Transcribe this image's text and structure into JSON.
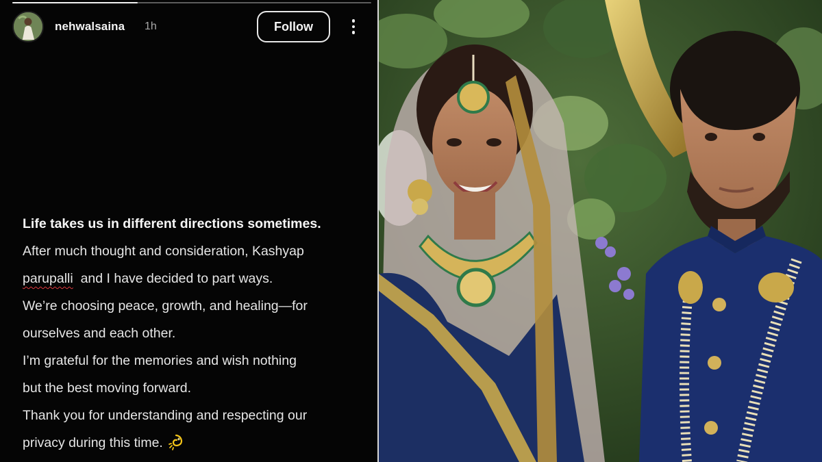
{
  "story": {
    "progress": 0.35,
    "username": "nehwalsaina",
    "time": "1h",
    "follow_label": "Follow",
    "more_icon": "more-vertical-icon",
    "text": {
      "headline": "Life takes us in different directions sometimes.",
      "line2": "After much thought and consideration, Kashyap",
      "mention": "parupalli",
      "line3_rest": "and I have decided to part ways.",
      "line4": "We’re choosing peace, growth, and healing—for",
      "line5": "ourselves and each other.",
      "line6": "I’m grateful for the memories and wish nothing",
      "line7": "but the best moving forward.",
      "line8": "Thank you for understanding and respecting our",
      "line9": "privacy during this time.",
      "emoji_icon": "dizzy-sparkle-icon"
    }
  },
  "photo": {
    "subject": "couple-wedding-photo"
  },
  "colors": {
    "background": "#050505",
    "text": "#e6e6e6",
    "secondary_text": "#a9a9a9",
    "spellcheck_underline": "#e0393e",
    "divider": "#d9d9d9",
    "sherwani_blue": "#1b2f6e",
    "gold": "#c9a84a"
  }
}
